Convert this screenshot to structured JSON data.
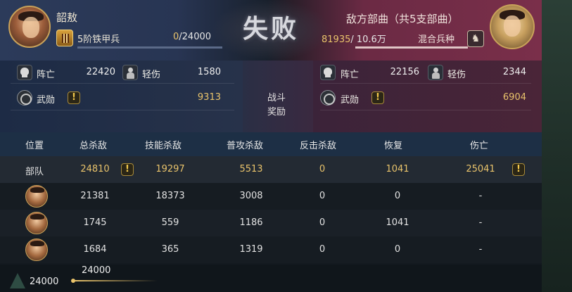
{
  "header": {
    "player_name": "韶敖",
    "unit_name": "5阶铁甲兵",
    "troops_current": "0",
    "troops_max": "/24000",
    "result": "失败",
    "enemy_title": "敌方部曲（共5支部曲）",
    "enemy_troops_current": "81935",
    "enemy_troops_max": "/ 10.6万",
    "enemy_type": "混合兵种"
  },
  "stats": {
    "left": {
      "killed_label": "阵亡",
      "killed_value": "22420",
      "wounded_label": "轻伤",
      "wounded_value": "1580",
      "merit_label": "武勋",
      "merit_value": "9313"
    },
    "reward_label_1": "战斗",
    "reward_label_2": "奖励",
    "right": {
      "killed_label": "阵亡",
      "killed_value": "22156",
      "wounded_label": "轻伤",
      "wounded_value": "2344",
      "merit_label": "武勋",
      "merit_value": "6904"
    }
  },
  "table": {
    "headers": [
      "位置",
      "总杀敌",
      "技能杀敌",
      "普攻杀敌",
      "反击杀敌",
      "恢复",
      "伤亡"
    ],
    "team_row": {
      "label": "部队",
      "total": "24810",
      "skill": "19297",
      "normal": "5513",
      "counter": "0",
      "recover": "1041",
      "casualty": "25041"
    },
    "generals": [
      {
        "total": "21381",
        "skill": "18373",
        "normal": "3008",
        "counter": "0",
        "recover": "0",
        "casualty": "-"
      },
      {
        "total": "1745",
        "skill": "559",
        "normal": "1186",
        "counter": "0",
        "recover": "1041",
        "casualty": "-"
      },
      {
        "total": "1684",
        "skill": "365",
        "normal": "1319",
        "counter": "0",
        "recover": "0",
        "casualty": "-"
      }
    ]
  },
  "footer": {
    "value_left": "24000",
    "value_top": "24000"
  },
  "icons": {
    "warn": "!",
    "mixed": "♞"
  },
  "colors": {
    "gold": "#e9c36b",
    "ally_blue": "#2c3b5a",
    "enemy_red": "#7a2f4a"
  }
}
